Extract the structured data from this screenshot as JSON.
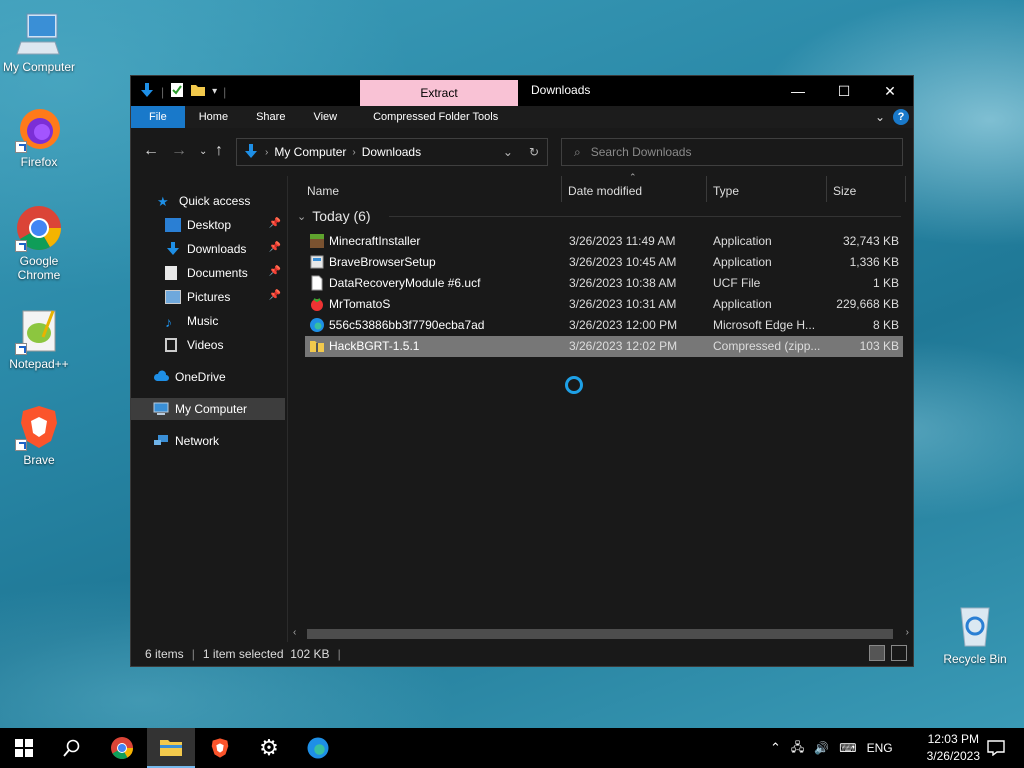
{
  "desktop": {
    "icons": [
      {
        "label": "My Computer"
      },
      {
        "label": "Firefox"
      },
      {
        "label": "Google Chrome"
      },
      {
        "label": "Notepad++"
      },
      {
        "label": "Brave"
      },
      {
        "label": "Recycle Bin"
      }
    ]
  },
  "window": {
    "title": "Downloads",
    "context_tab": "Extract",
    "ribbon_tabs": [
      "File",
      "Home",
      "Share",
      "View",
      "Compressed Folder Tools"
    ],
    "controls": {
      "minimize": "—",
      "maximize": "☐",
      "close": "✕"
    },
    "help": "?"
  },
  "address": {
    "parts": [
      "My Computer",
      "Downloads"
    ]
  },
  "search": {
    "placeholder": "Search Downloads"
  },
  "sidebar": {
    "items": [
      {
        "label": "Quick access",
        "icon": "star-icon"
      },
      {
        "label": "Desktop",
        "icon": "desktop-folder-icon",
        "pinned": true
      },
      {
        "label": "Downloads",
        "icon": "downloads-folder-icon",
        "pinned": true
      },
      {
        "label": "Documents",
        "icon": "documents-folder-icon",
        "pinned": true
      },
      {
        "label": "Pictures",
        "icon": "pictures-folder-icon",
        "pinned": true
      },
      {
        "label": "Music",
        "icon": "music-folder-icon"
      },
      {
        "label": "Videos",
        "icon": "videos-folder-icon"
      },
      {
        "label": "OneDrive",
        "icon": "cloud-icon"
      },
      {
        "label": "My Computer",
        "icon": "computer-icon",
        "selected": true
      },
      {
        "label": "Network",
        "icon": "network-icon"
      }
    ]
  },
  "columns": {
    "name": "Name",
    "date": "Date modified",
    "type": "Type",
    "size": "Size"
  },
  "group": {
    "label": "Today (6)"
  },
  "files": [
    {
      "name": "MinecraftInstaller",
      "date": "3/26/2023 11:49 AM",
      "type": "Application",
      "size": "32,743 KB",
      "icon": "minecraft-icon"
    },
    {
      "name": "BraveBrowserSetup",
      "date": "3/26/2023 10:45 AM",
      "type": "Application",
      "size": "1,336 KB",
      "icon": "installer-icon"
    },
    {
      "name": "DataRecoveryModule #6.ucf",
      "date": "3/26/2023 10:38 AM",
      "type": "UCF File",
      "size": "1 KB",
      "icon": "blank-file-icon"
    },
    {
      "name": "MrTomatoS",
      "date": "3/26/2023 10:31 AM",
      "type": "Application",
      "size": "229,668 KB",
      "icon": "tomato-icon"
    },
    {
      "name": "556c53886bb3f7790ecba7ad",
      "date": "3/26/2023 12:00 PM",
      "type": "Microsoft Edge H...",
      "size": "8 KB",
      "icon": "edge-icon"
    },
    {
      "name": "HackBGRT-1.5.1",
      "date": "3/26/2023 12:02 PM",
      "type": "Compressed (zipp...",
      "size": "103 KB",
      "icon": "zip-folder-icon",
      "selected": true
    }
  ],
  "status": {
    "items": "6 items",
    "selected": "1 item selected  102 KB"
  },
  "taskbar": {
    "apps": [
      "start-icon",
      "search-icon",
      "chrome-icon",
      "file-explorer-icon",
      "brave-icon",
      "settings-icon",
      "edge-icon"
    ],
    "language": "ENG",
    "time": "12:03 PM",
    "date": "3/26/2023"
  }
}
